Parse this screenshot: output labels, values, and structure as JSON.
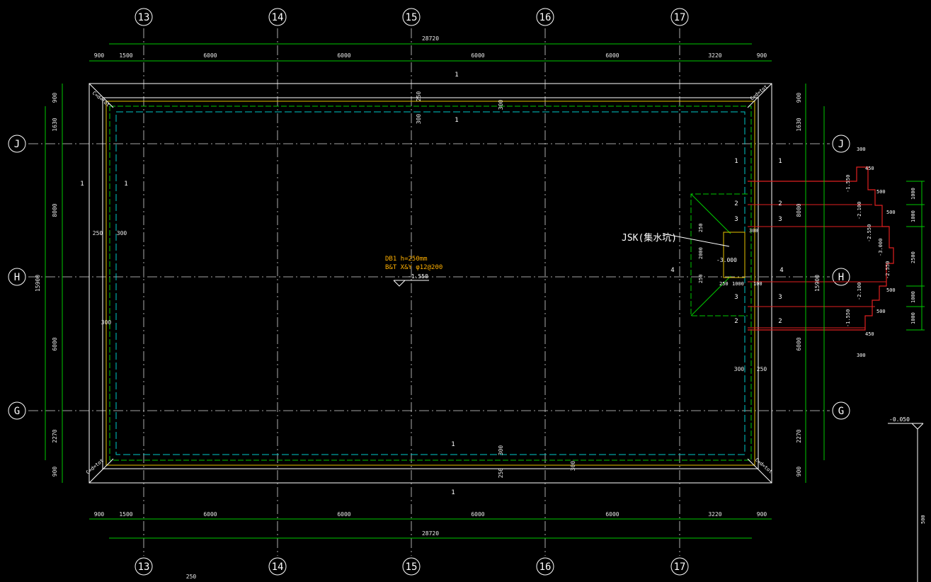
{
  "grid": {
    "columns": [
      "13",
      "14",
      "15",
      "16",
      "17"
    ],
    "rows": [
      "J",
      "H",
      "G"
    ]
  },
  "dims": {
    "total_width": "28720",
    "top_chain": [
      "900",
      "1500",
      "6000",
      "6000",
      "6000",
      "6000",
      "3220",
      "900"
    ],
    "bottom_chain": [
      "900",
      "1500",
      "6000",
      "6000",
      "6000",
      "6000",
      "3220",
      "900"
    ],
    "left_chain": [
      "900",
      "1630",
      "8000",
      "6000",
      "2270",
      "900"
    ],
    "left_total": "15900",
    "right_chain": [
      "900",
      "1630",
      "8000",
      "6000",
      "2270",
      "900"
    ],
    "right_total": "15900",
    "wall_250": "250",
    "wall_300": "300",
    "bottom_extra": "250",
    "right_elev_value": "500"
  },
  "labels": {
    "slab_note_1": "DB1 h=250mm",
    "slab_note_2": "B&T X&Y φ12@200",
    "slab_level": "-1.550",
    "pit_label": "JSK(集水坑)",
    "pit_level": "-3.000",
    "pit_dims": [
      "250",
      "2000",
      "250",
      "250",
      "1000",
      "100",
      "300"
    ],
    "right_level": "-0.050",
    "corner_tag": "C=d=tot"
  },
  "sections": {
    "top": "1",
    "top_inner": "1",
    "bottom": "1",
    "bottom_inner": "1",
    "left": "1",
    "left_inner": "1",
    "pit": [
      "1",
      "2",
      "3",
      "4",
      "3",
      "2"
    ],
    "right": [
      "1",
      "2",
      "3",
      "4",
      "3",
      "2"
    ]
  },
  "stair_detail": {
    "dims_right": [
      "1000",
      "1000",
      "2500",
      "1000",
      "1000"
    ],
    "steps_500": [
      "500",
      "500",
      "500",
      "500"
    ],
    "levels": [
      "-1.550",
      "-2.100",
      "-2.550",
      "-3.000",
      "-2.550",
      "-2.100",
      "-1.550"
    ],
    "top_300": "300",
    "top_450": "450",
    "bottom_450": "450",
    "bottom_300": "300"
  }
}
